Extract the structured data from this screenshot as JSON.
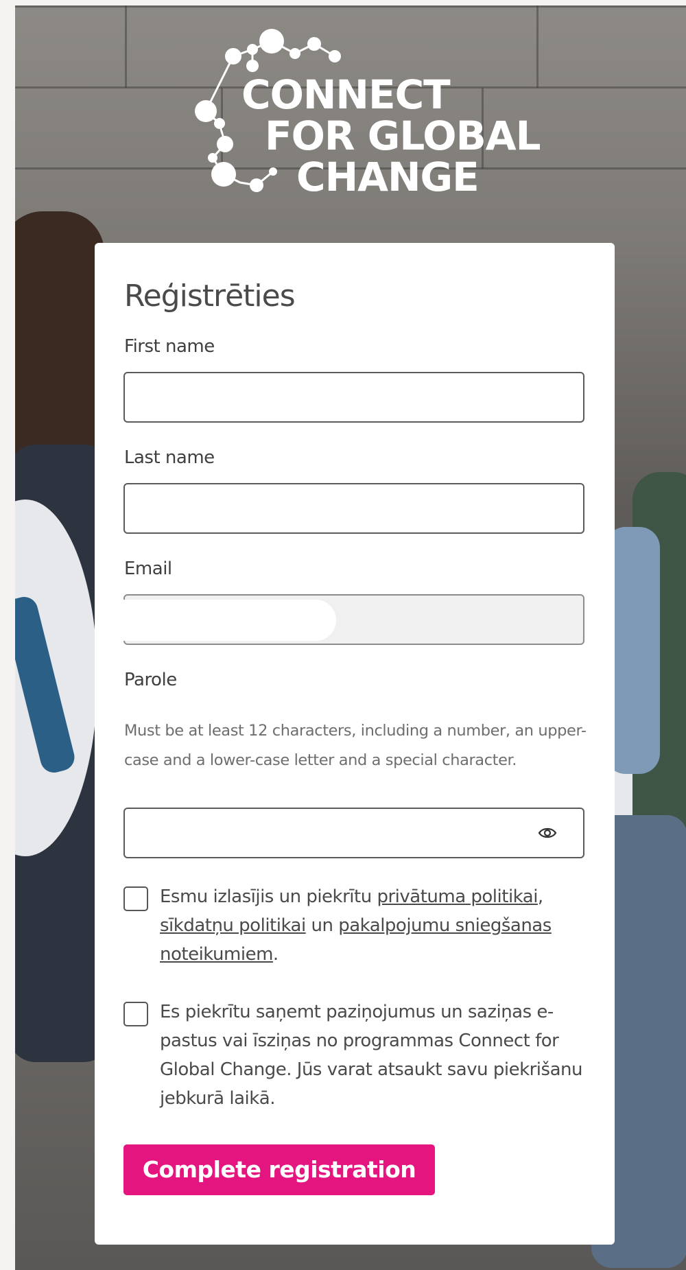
{
  "brand": {
    "logo_lines": [
      "CONNECT",
      "FOR GLOBAL",
      "CHANGE"
    ],
    "accent_color": "#e5157f"
  },
  "form": {
    "title": "Reģistrēties",
    "fields": {
      "first_name": {
        "label": "First name",
        "value": ""
      },
      "last_name": {
        "label": "Last name",
        "value": ""
      },
      "email": {
        "label": "Email",
        "value": ""
      },
      "password": {
        "label": "Parole",
        "hint": "Must be at least 12 characters, including a number, an upper-case and a lower-case letter and a special character.",
        "value": "",
        "toggle_icon": "eye-icon"
      }
    },
    "consent_policy": {
      "text_1": "Esmu izlasījis un piekrītu ",
      "link_privacy": "privātuma politikai",
      "text_2": ", ",
      "link_cookies": "sīkdatņu politikai",
      "text_3": " un ",
      "link_terms": "pakalpojumu sniegšanas noteikumiem",
      "text_4": ".",
      "checked": false
    },
    "consent_marketing": {
      "text": "Es piekrītu saņemt paziņojumus un saziņas e-pastus vai īsziņas no programmas Connect for Global Change. Jūs varat atsaukt savu piekrišanu jebkurā laikā.",
      "checked": false
    },
    "submit_label": "Complete registration"
  }
}
